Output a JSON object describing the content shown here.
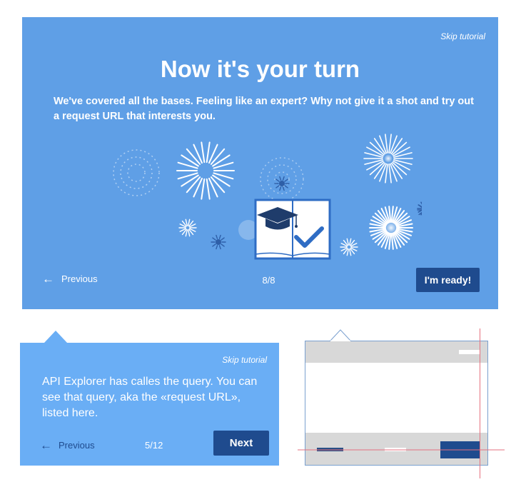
{
  "tutorial": {
    "skip_label": "Skip tutorial",
    "title": "Now it's your turn",
    "body": "We've covered all the bases. Feeling like an expert? Why not give it a shot and try out a request URL that interests you.",
    "illustration_icons": [
      "fireworks-icon",
      "graduation-cap-icon",
      "checkmark-icon",
      "book-icon"
    ],
    "previous_label": "Previous",
    "page_indicator": "8/8",
    "ready_label": "I'm ready!"
  },
  "popover": {
    "skip_label": "Skip tutorial",
    "body": "API Explorer has calles the query. You can see that query, aka the «request URL», listed here.",
    "previous_label": "Previous",
    "page_indicator": "5/12",
    "next_label": "Next"
  },
  "colors": {
    "panel_blue": "#5f9fe6",
    "popover_blue": "#6aaef5",
    "button_navy": "#1f4b8e",
    "wireframe_gray": "#d8d8d8",
    "guide_red": "#e5717f"
  }
}
